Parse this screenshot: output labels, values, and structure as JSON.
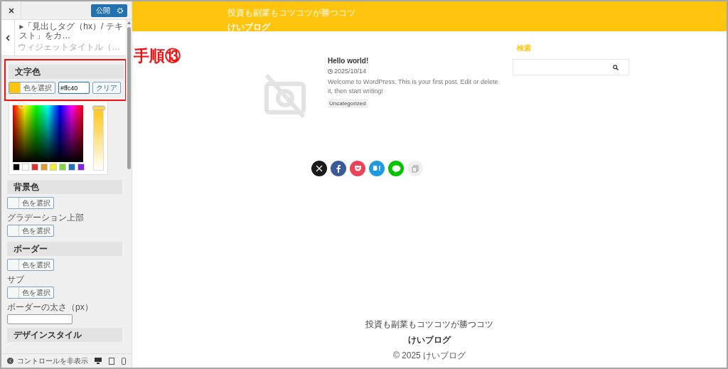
{
  "sidebar": {
    "publish_button": "公開",
    "breadcrumb": "▸「見出しタグ（hx）/ テキスト」をカ…",
    "title": "ウィジェットタイトル（…",
    "sections": [
      {
        "kind": "group",
        "highlighted": true,
        "items": [
          {
            "kind": "heading",
            "text": "文字色"
          },
          {
            "kind": "color",
            "button_label": "色を選択",
            "color": "#ffc40d",
            "hex_value": "#ffc40",
            "clear_label": "クリア"
          }
        ]
      },
      {
        "kind": "picker",
        "level": 1,
        "palette": [
          {
            "color": "#000000"
          },
          {
            "color": "#ffffff"
          },
          {
            "color": "#dd3333"
          },
          {
            "color": "#dd9933"
          },
          {
            "color": "#eeee22"
          },
          {
            "color": "#81d742"
          },
          {
            "color": "#1e73be"
          },
          {
            "color": "#8224e3"
          }
        ]
      },
      {
        "kind": "heading",
        "text": "背景色"
      },
      {
        "kind": "color",
        "button_label": "色を選択"
      },
      {
        "kind": "label",
        "text": "グラデーション上部"
      },
      {
        "kind": "color",
        "button_label": "色を選択"
      },
      {
        "kind": "heading",
        "text": "ボーダー"
      },
      {
        "kind": "color",
        "button_label": "色を選択"
      },
      {
        "kind": "label",
        "text": "サブ"
      },
      {
        "kind": "color",
        "button_label": "色を選択"
      },
      {
        "kind": "label",
        "text": "ボーダーの太さ（px）"
      },
      {
        "kind": "input"
      },
      {
        "kind": "heading",
        "text": "デザインスタイル"
      }
    ],
    "hide_controls": "コントロールを非表示"
  },
  "annotation": {
    "label": "手順⑬"
  },
  "preview": {
    "header": {
      "tagline": "投資も副業もコツコツが勝つコツ",
      "title": "けいブログ"
    },
    "post": {
      "title": "Hello world!",
      "date": "2025/10/14",
      "excerpt": "Welcome to WordPress. This is your first post. Edit or delete it, then start writing!",
      "tag": "Uncategorized"
    },
    "widget": {
      "title": "検索"
    },
    "share": [
      {
        "kind": "x"
      },
      {
        "kind": "facebook"
      },
      {
        "kind": "pocket"
      },
      {
        "kind": "hatena"
      },
      {
        "kind": "line"
      },
      {
        "kind": "copy"
      }
    ],
    "footer": {
      "tagline": "投資も副業もコツコツが勝つコツ",
      "title": "けいブログ",
      "copyright": "© 2025 けいブログ"
    }
  }
}
